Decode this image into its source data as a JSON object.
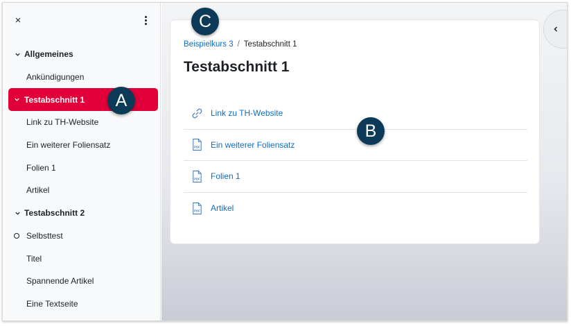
{
  "sidebar": {
    "close_icon": "×",
    "items": [
      {
        "label": "Allgemeines",
        "type": "section"
      },
      {
        "label": "Ankündigungen",
        "type": "activity"
      },
      {
        "label": "Testabschnitt 1",
        "type": "section",
        "active": true
      },
      {
        "label": "Link zu TH-Website",
        "type": "activity"
      },
      {
        "label": "Ein weiterer Foliensatz",
        "type": "activity"
      },
      {
        "label": "Folien 1",
        "type": "activity"
      },
      {
        "label": "Artikel",
        "type": "activity"
      },
      {
        "label": "Testabschnitt 2",
        "type": "section"
      },
      {
        "label": "Selbsttest",
        "type": "activity"
      },
      {
        "label": "Titel",
        "type": "activity"
      },
      {
        "label": "Spannende Artikel",
        "type": "activity"
      },
      {
        "label": "Eine Textseite",
        "type": "activity"
      }
    ]
  },
  "breadcrumb": {
    "course": "Beispielkurs 3",
    "separator": "/",
    "current": "Testabschnitt 1"
  },
  "main": {
    "title": "Testabschnitt 1",
    "activities": [
      {
        "label": "Link zu TH-Website",
        "icon": "link-icon"
      },
      {
        "label": "Ein weiterer Foliensatz",
        "icon": "pdf-icon"
      },
      {
        "label": "Folien 1",
        "icon": "pdf-icon"
      },
      {
        "label": "Artikel",
        "icon": "pdf-icon"
      }
    ]
  },
  "markers": {
    "a": "A",
    "b": "B",
    "c": "C"
  },
  "colors": {
    "accent": "#e2003a",
    "link": "#0f6cbf",
    "marker": "#0d3a56"
  }
}
